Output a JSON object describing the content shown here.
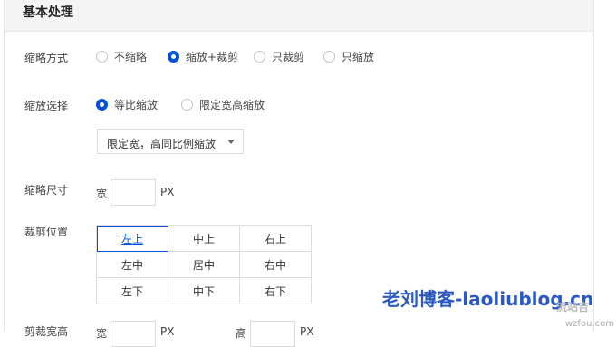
{
  "section": {
    "title": "基本处理"
  },
  "thumb_mode": {
    "label": "缩略方式",
    "options": [
      {
        "label": "不缩略",
        "checked": false
      },
      {
        "label": "缩放+裁剪",
        "checked": true
      },
      {
        "label": "只裁剪",
        "checked": false
      },
      {
        "label": "只缩放",
        "checked": false
      }
    ]
  },
  "scale_select": {
    "label": "缩放选择",
    "options": [
      {
        "label": "等比缩放",
        "checked": true
      },
      {
        "label": "限定宽高缩放",
        "checked": false
      }
    ],
    "dropdown_value": "限定宽，高同比例缩放"
  },
  "thumb_size": {
    "label": "缩略尺寸",
    "width_prefix": "宽",
    "unit": "PX",
    "width_value": ""
  },
  "crop_position": {
    "label": "裁剪位置",
    "cells": [
      "左上",
      "中上",
      "右上",
      "左中",
      "居中",
      "右中",
      "左下",
      "中下",
      "右下"
    ],
    "selected": "左上"
  },
  "crop_size": {
    "label": "剪裁宽高",
    "width_prefix": "宽",
    "height_prefix": "高",
    "unit": "PX"
  },
  "watermark": {
    "text": "老刘博客-laoliublog.cn",
    "logo": "流站吉",
    "site": "wzfou.com"
  },
  "colors": {
    "accent": "#0052d9",
    "header_bg": "#f4f4f5",
    "border": "#dcdcdc"
  }
}
